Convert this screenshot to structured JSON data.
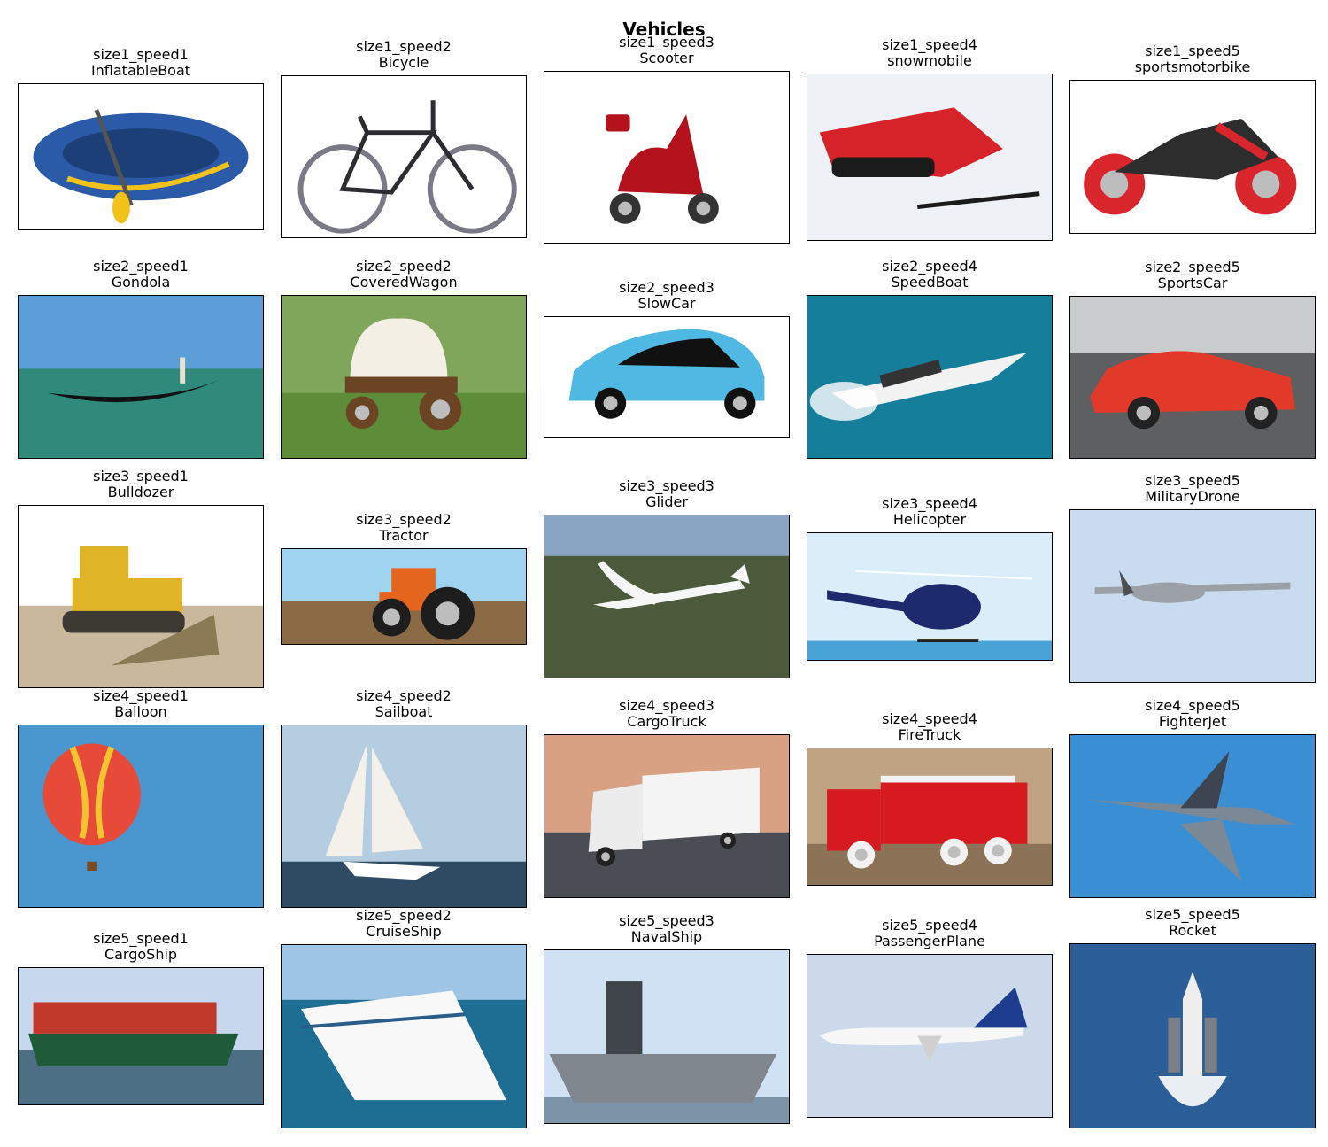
{
  "title": "Vehicles",
  "panels": [
    {
      "code": "size1_speed1",
      "name": "InflatableBoat",
      "scene": "inflatable-boat-icon",
      "colors": {
        "bg": "#ffffff",
        "ground": "#ffffff",
        "main": "#2a5aa8",
        "accent": "#f2c21b"
      }
    },
    {
      "code": "size1_speed2",
      "name": "Bicycle",
      "scene": "bicycle-icon",
      "colors": {
        "bg": "#ffffff",
        "ground": "#ffffff",
        "main": "#2b2b30",
        "accent": "#7a7a86"
      }
    },
    {
      "code": "size1_speed3",
      "name": "Scooter",
      "scene": "scooter-icon",
      "colors": {
        "bg": "#ffffff",
        "ground": "#ffffff",
        "main": "#b3121c",
        "accent": "#333333"
      }
    },
    {
      "code": "size1_speed4",
      "name": "snowmobile",
      "scene": "snowmobile-icon",
      "colors": {
        "bg": "#eef1f5",
        "ground": "#e1e5eb",
        "main": "#d6232a",
        "accent": "#1b1b1b"
      }
    },
    {
      "code": "size1_speed5",
      "name": "sportsmotorbike",
      "scene": "motorbike-icon",
      "colors": {
        "bg": "#ffffff",
        "ground": "#ffffff",
        "main": "#2d2d2d",
        "accent": "#d8262c"
      }
    },
    {
      "code": "size2_speed1",
      "name": "Gondola",
      "scene": "gondola-icon",
      "colors": {
        "bg": "#5b9ed8",
        "ground": "#2f8a7c",
        "main": "#111111",
        "accent": "#e8e2d0"
      }
    },
    {
      "code": "size2_speed2",
      "name": "CoveredWagon",
      "scene": "wagon-icon",
      "colors": {
        "bg": "#7fa65a",
        "ground": "#5e8d3a",
        "main": "#f3efe4",
        "accent": "#6b4424"
      }
    },
    {
      "code": "size2_speed3",
      "name": "SlowCar",
      "scene": "small-car-icon",
      "colors": {
        "bg": "#ffffff",
        "ground": "#ffffff",
        "main": "#4fb8e3",
        "accent": "#111111"
      }
    },
    {
      "code": "size2_speed4",
      "name": "SpeedBoat",
      "scene": "speedboat-icon",
      "colors": {
        "bg": "#157e9a",
        "ground": "#0d6a85",
        "main": "#f2f2f2",
        "accent": "#333333"
      }
    },
    {
      "code": "size2_speed5",
      "name": "SportsCar",
      "scene": "sports-car-icon",
      "colors": {
        "bg": "#c9cccd",
        "ground": "#5e5f60",
        "main": "#e23a2a",
        "accent": "#222222"
      }
    },
    {
      "code": "size3_speed1",
      "name": "Bulldozer",
      "scene": "bulldozer-icon",
      "colors": {
        "bg": "#ffffff",
        "ground": "#c9b89c",
        "main": "#e0b427",
        "accent": "#3d3a33"
      }
    },
    {
      "code": "size3_speed2",
      "name": "Tractor",
      "scene": "tractor-icon",
      "colors": {
        "bg": "#9fd3ee",
        "ground": "#8a6a45",
        "main": "#e4651d",
        "accent": "#1d1d1d"
      }
    },
    {
      "code": "size3_speed3",
      "name": "Glider",
      "scene": "glider-icon",
      "colors": {
        "bg": "#8aa4c4",
        "ground": "#4a5a3a",
        "main": "#f6f6f6",
        "accent": "#222222"
      }
    },
    {
      "code": "size3_speed4",
      "name": "Helicopter",
      "scene": "helicopter-icon",
      "colors": {
        "bg": "#d9eef8",
        "ground": "#4aa3d6",
        "main": "#1d2a6e",
        "accent": "#ffffff"
      }
    },
    {
      "code": "size3_speed5",
      "name": "MilitaryDrone",
      "scene": "drone-icon",
      "colors": {
        "bg": "#c9dbee",
        "ground": "#a9bcd0",
        "main": "#9aa0a6",
        "accent": "#4b4f54"
      }
    },
    {
      "code": "size4_speed1",
      "name": "Balloon",
      "scene": "hot-air-balloon-icon",
      "colors": {
        "bg": "#4a97cf",
        "ground": "#8fc1e3",
        "main": "#e84a3a",
        "accent": "#f4c430"
      }
    },
    {
      "code": "size4_speed2",
      "name": "Sailboat",
      "scene": "sailboat-icon",
      "colors": {
        "bg": "#b5cde0",
        "ground": "#2f4a63",
        "main": "#f4f1ea",
        "accent": "#333333"
      }
    },
    {
      "code": "size4_speed3",
      "name": "CargoTruck",
      "scene": "cargo-truck-icon",
      "colors": {
        "bg": "#d9a184",
        "ground": "#4b4d55",
        "main": "#f4f4f4",
        "accent": "#222222"
      }
    },
    {
      "code": "size4_speed4",
      "name": "FireTruck",
      "scene": "fire-truck-icon",
      "colors": {
        "bg": "#c0a383",
        "ground": "#8c7256",
        "main": "#d71920",
        "accent": "#f2f2f2"
      }
    },
    {
      "code": "size4_speed5",
      "name": "FighterJet",
      "scene": "fighter-jet-icon",
      "colors": {
        "bg": "#3a8fd4",
        "ground": "#3a8fd4",
        "main": "#7b8896",
        "accent": "#3c4550"
      }
    },
    {
      "code": "size5_speed1",
      "name": "CargoShip",
      "scene": "cargo-ship-icon",
      "colors": {
        "bg": "#c7d8ee",
        "ground": "#4c6f86",
        "main": "#1f5a3a",
        "accent": "#c0392b"
      }
    },
    {
      "code": "size5_speed2",
      "name": "CruiseShip",
      "scene": "cruise-ship-icon",
      "colors": {
        "bg": "#9ec4e6",
        "ground": "#1e6d93",
        "main": "#f8f8f8",
        "accent": "#2b5d8a"
      }
    },
    {
      "code": "size5_speed3",
      "name": "NavalShip",
      "scene": "naval-ship-icon",
      "colors": {
        "bg": "#cfe1f2",
        "ground": "#7d93a8",
        "main": "#7f868e",
        "accent": "#3e444a"
      }
    },
    {
      "code": "size5_speed4",
      "name": "PassengerPlane",
      "scene": "passenger-plane-icon",
      "colors": {
        "bg": "#cbd9ea",
        "ground": "#e4ecf5",
        "main": "#f7f7f7",
        "accent": "#1f3d8f"
      }
    },
    {
      "code": "size5_speed5",
      "name": "Rocket",
      "scene": "rocket-icon",
      "colors": {
        "bg": "#2c5f97",
        "ground": "#e9eef3",
        "main": "#eeeeee",
        "accent": "#7a7f85"
      }
    }
  ]
}
